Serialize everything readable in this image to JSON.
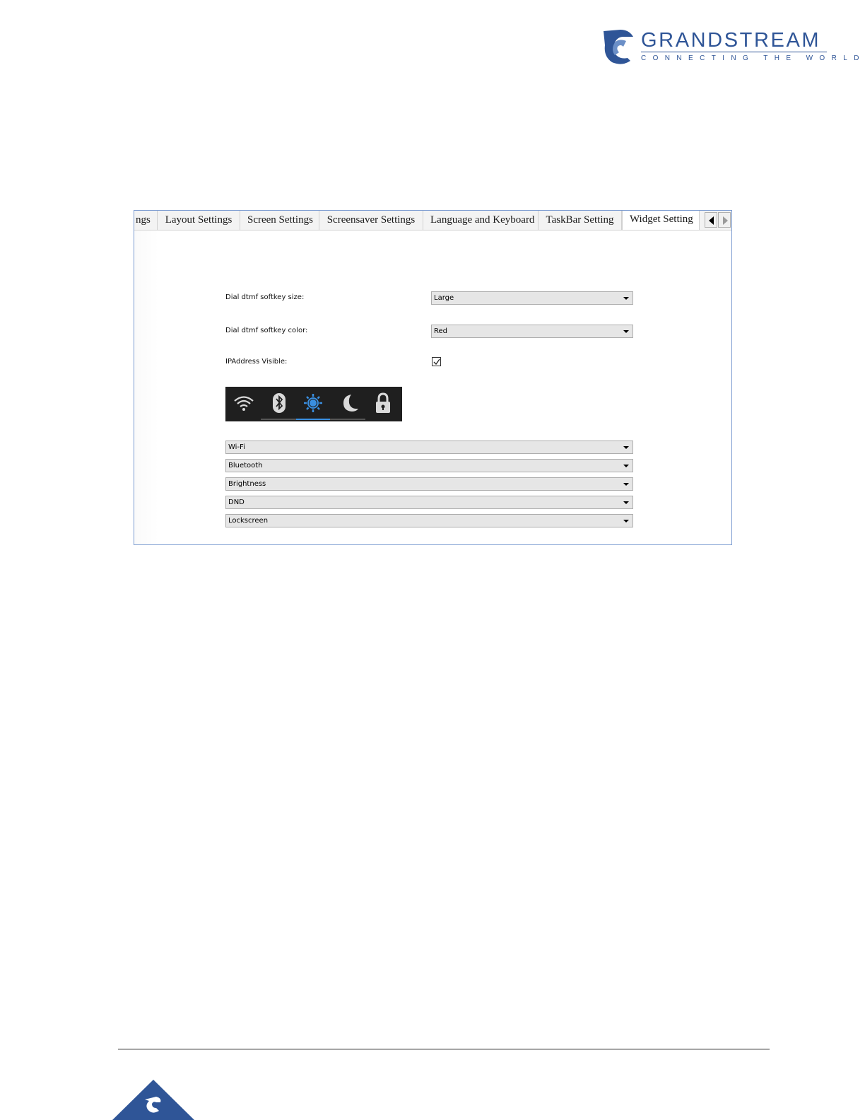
{
  "brand": {
    "name": "GRANDSTREAM",
    "tagline": "CONNECTING THE WORLD",
    "color": "#2f5597"
  },
  "tabs": [
    {
      "label": "ngs"
    },
    {
      "label": "Layout Settings"
    },
    {
      "label": "Screen Settings"
    },
    {
      "label": "Screensaver Settings"
    },
    {
      "label": "Language and Keyboard"
    },
    {
      "label": "TaskBar Setting"
    },
    {
      "label": "Widget Setting",
      "active": true
    }
  ],
  "tab_nav": {
    "prev_icon": "arrow-left-icon",
    "next_icon": "arrow-right-icon"
  },
  "form": {
    "dtmf_size": {
      "label": "Dial dtmf softkey size:",
      "value": "Large"
    },
    "dtmf_color": {
      "label": "Dial dtmf softkey color:",
      "value": "Red"
    },
    "ip_visible": {
      "label": "IPAddress Visible:",
      "checked": true
    }
  },
  "widget_preview": {
    "icons": [
      "wifi-icon",
      "bluetooth-icon",
      "brightness-icon",
      "moon-icon",
      "lock-icon"
    ],
    "accent": "#3a8fe0"
  },
  "widget_slots": [
    {
      "value": "Wi-Fi"
    },
    {
      "value": "Bluetooth"
    },
    {
      "value": "Brightness"
    },
    {
      "value": "DND"
    },
    {
      "value": "Lockscreen"
    }
  ]
}
